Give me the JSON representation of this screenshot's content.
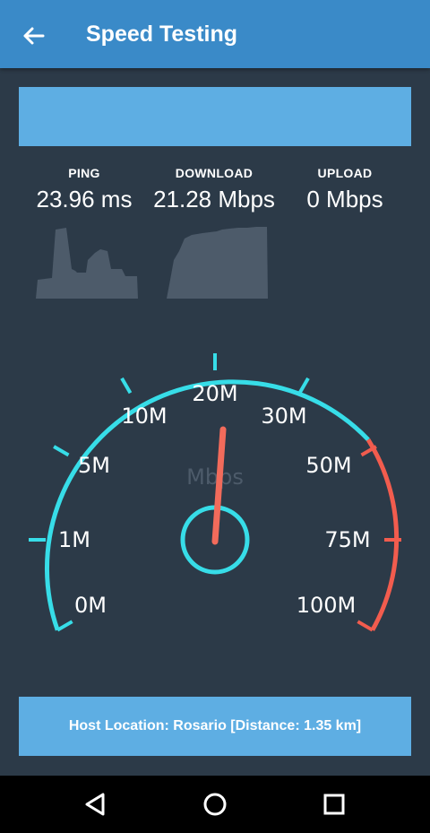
{
  "app_bar": {
    "title": "Speed Testing",
    "back_icon": "arrow-back-icon"
  },
  "stats": {
    "ping": {
      "label": "PING",
      "value": "23.96 ms"
    },
    "download": {
      "label": "DOWNLOAD",
      "value": "21.28 Mbps"
    },
    "upload": {
      "label": "UPLOAD",
      "value": "0 Mbps"
    }
  },
  "gauge": {
    "unit": "Mbps",
    "ticks": [
      "0M",
      "1M",
      "5M",
      "10M",
      "20M",
      "30M",
      "50M",
      "75M",
      "100M"
    ],
    "current_speed_mbps": 21.28,
    "colors": {
      "normal": "#37dde8",
      "high": "#f25c4e",
      "needle": "#f26b5b"
    }
  },
  "host": {
    "text": "Host Location: Rosario [Distance: 1.35 km]"
  },
  "colors": {
    "app_bar": "#3a8ac8",
    "background": "#2c3a48",
    "panel": "#5eaee3"
  },
  "nav_bar": {
    "back": "nav-back-icon",
    "home": "nav-home-icon",
    "recents": "nav-recents-icon"
  }
}
